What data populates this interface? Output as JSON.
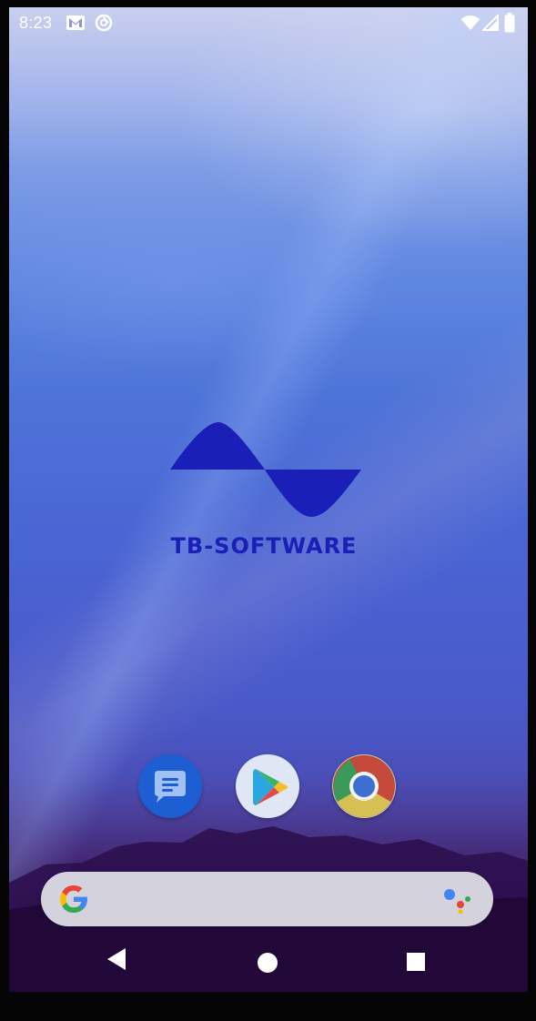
{
  "status_bar": {
    "time": "8:23",
    "left_icons": [
      "gmail-icon",
      "sync-icon"
    ],
    "right_icons": [
      "wifi-icon",
      "cellular-signal-icon",
      "battery-icon"
    ]
  },
  "wallpaper_logo": {
    "text": "TB-SOFTWARE",
    "color": "#1a1fb8"
  },
  "dock": [
    {
      "name": "messages",
      "icon": "messages-icon"
    },
    {
      "name": "play-store",
      "icon": "play-store-icon"
    },
    {
      "name": "chrome",
      "icon": "chrome-icon"
    }
  ],
  "search_bar": {
    "left_icon": "google-g-icon",
    "right_icon": "google-assistant-icon"
  },
  "nav_bar": {
    "buttons": [
      "back-icon",
      "home-icon",
      "recents-icon"
    ]
  }
}
